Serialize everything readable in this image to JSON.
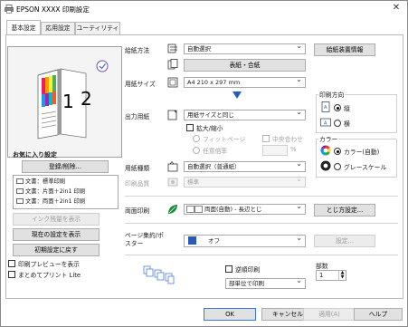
{
  "window": {
    "title": "EPSON XXXX 印刷設定",
    "close_glyph": "✕"
  },
  "tabs": [
    {
      "label": "基本設定"
    },
    {
      "label": "応用設定"
    },
    {
      "label": "ユーティリティー"
    }
  ],
  "preview": {
    "page_number_front": "1",
    "page_number_back": "2"
  },
  "favorites": {
    "title": "お気に入り設定",
    "register_button": "登録/削除...",
    "items": [
      "文書：標準印刷",
      "文書：片面＋2in1 印刷",
      "文書：両面＋2in1 印刷"
    ]
  },
  "left_buttons": {
    "ink_level": "インク残量を表示",
    "show_current": "現在の設定を表示",
    "reset_defaults": "初期設定に戻す"
  },
  "left_checks": {
    "print_preview": "印刷プレビューを表示",
    "batch_print": "まとめてプリント Lite"
  },
  "settings": {
    "paper_source": {
      "label": "給紙方法",
      "value": "自動選択",
      "info_button": "給紙装置情報"
    },
    "front_back_button": "表紙・合紙",
    "paper_size": {
      "label": "用紙サイズ",
      "value": "A4 210 x 297 mm"
    },
    "output_paper": {
      "label": "出力用紙",
      "value": "用紙サイズと同じ"
    },
    "scale": {
      "label": "拡大/縮小",
      "fit_page": "フィットページ",
      "center": "中央合わせ",
      "any_ratio": "任意倍率",
      "ratio_unit": "%"
    },
    "paper_type": {
      "label": "用紙種類",
      "value": "自動選択（普通紙）"
    },
    "print_quality": {
      "label": "印刷品質",
      "value": "標準"
    },
    "duplex": {
      "label": "両面印刷",
      "value": "両面(自動) - 長辺とじ",
      "binding_button": "とじ方設定..."
    },
    "layout": {
      "label": "ページ集約/ポスター",
      "value": "オフ",
      "settings_button": "設定..."
    },
    "orientation": {
      "title": "印刷方向",
      "portrait": "縦",
      "landscape": "横"
    },
    "color": {
      "title": "カラー",
      "color_option": "カラー(自動)",
      "gray_option": "グレースケール"
    },
    "reverse_print": "逆順印刷",
    "collate": {
      "value": "部単位で印刷"
    },
    "copies": {
      "label": "部数",
      "value": "1"
    }
  },
  "footer": {
    "ok": "OK",
    "cancel": "キャンセル",
    "apply": "適用(A)",
    "help": "ヘルプ"
  },
  "colors": {
    "accent_arrow": "#1f5fbf",
    "duplex_icon": "#1b8a3a",
    "layout_swatch": "#2a5bb5"
  }
}
